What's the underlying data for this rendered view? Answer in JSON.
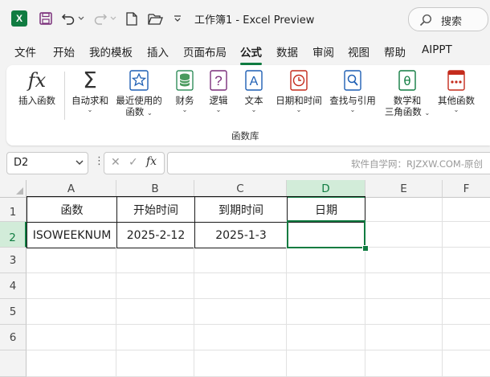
{
  "titlebar": {
    "app_icon": "X",
    "title": "工作簿1  -  Excel Preview",
    "search_placeholder": "搜索"
  },
  "tabs": [
    {
      "label": "文件",
      "active": false
    },
    {
      "label": "开始",
      "active": false
    },
    {
      "label": "我的模板",
      "active": false
    },
    {
      "label": "插入",
      "active": false
    },
    {
      "label": "页面布局",
      "active": false
    },
    {
      "label": "公式",
      "active": true
    },
    {
      "label": "数据",
      "active": false
    },
    {
      "label": "审阅",
      "active": false
    },
    {
      "label": "视图",
      "active": false
    },
    {
      "label": "帮助",
      "active": false
    },
    {
      "label": "AIPPT",
      "active": false
    }
  ],
  "ribbon": {
    "insert_function": {
      "line1": "插入函数",
      "icon": "fx-icon"
    },
    "autosum": {
      "line1": "自动求和",
      "icon": "sigma-icon"
    },
    "recent": {
      "line1": "最近使用的",
      "line2": "函数",
      "icon": "star-icon"
    },
    "financial": {
      "line1": "财务",
      "icon": "database-icon"
    },
    "logical": {
      "line1": "逻辑",
      "icon": "question-icon"
    },
    "text": {
      "line1": "文本",
      "icon": "letter-a-icon"
    },
    "datetime": {
      "line1": "日期和时间",
      "icon": "clock-icon"
    },
    "lookup": {
      "line1": "查找与引用",
      "icon": "search-icon"
    },
    "math": {
      "line1": "数学和",
      "line2": "三角函数",
      "icon": "theta-icon"
    },
    "more": {
      "line1": "其他函数",
      "icon": "more-icon"
    },
    "group_label": "函数库"
  },
  "formula_bar": {
    "name_box": "D2",
    "watermark": "软件自学网：RJZXW.COM-原创",
    "formula": ""
  },
  "sheet": {
    "columns": [
      "A",
      "B",
      "C",
      "D",
      "E",
      "F"
    ],
    "rows": [
      "1",
      "2",
      "3",
      "4",
      "5",
      "6"
    ],
    "selected_cell": "D2",
    "cells": {
      "A1": "函数",
      "B1": "开始时间",
      "C1": "到期时间",
      "D1": "日期",
      "A2": "ISOWEEKNUM",
      "B2": "2025-2-12",
      "C2": "2025-1-3",
      "D2": ""
    }
  },
  "colors": {
    "accent": "#107c41",
    "selected_header": "#d2ecd9"
  }
}
